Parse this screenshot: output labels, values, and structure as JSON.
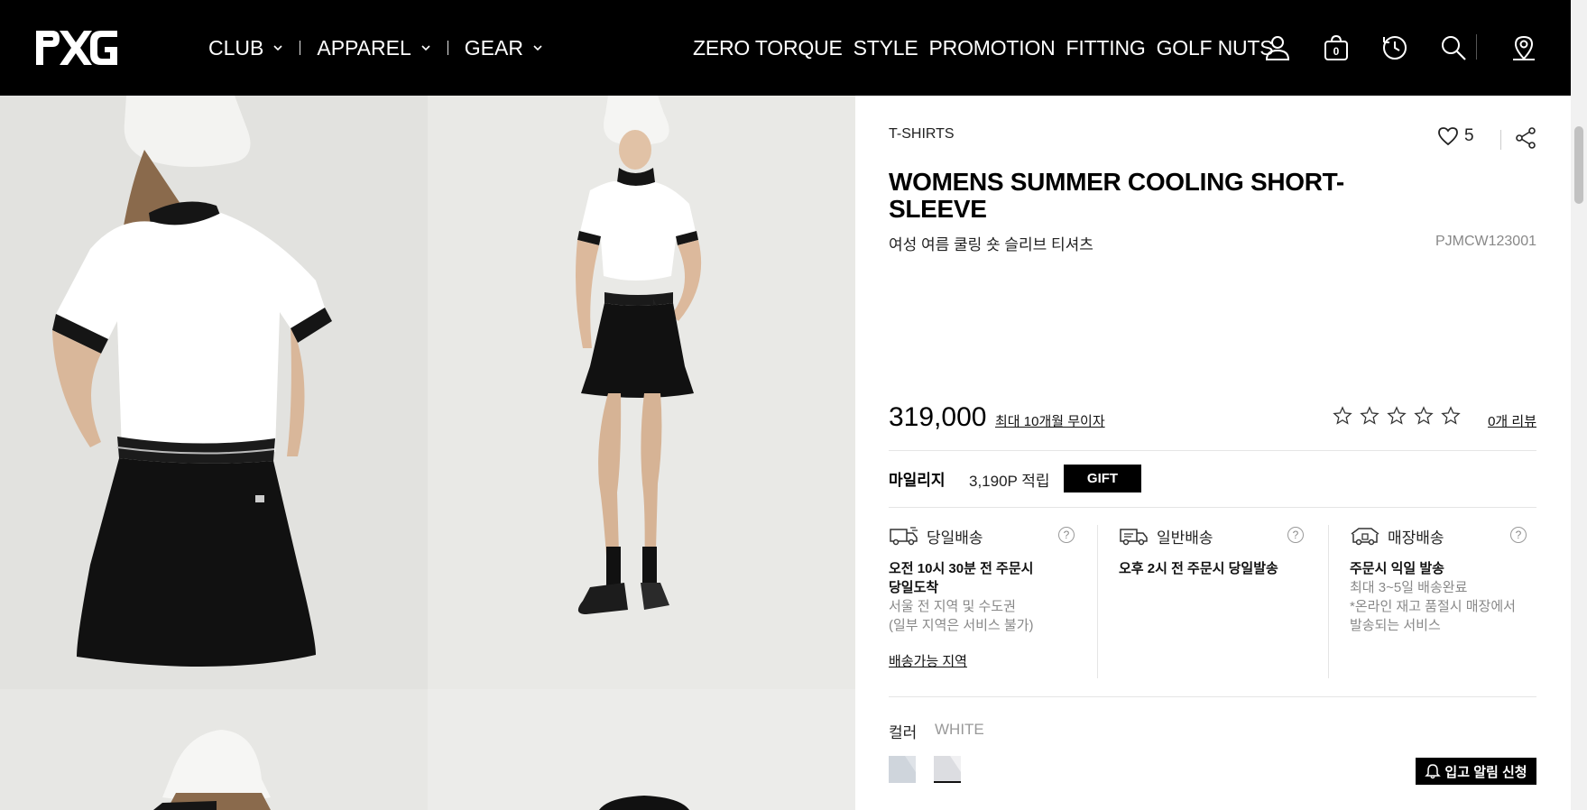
{
  "header": {
    "logo": "PXG",
    "nav_left": [
      {
        "label": "CLUB"
      },
      {
        "label": "APPAREL"
      },
      {
        "label": "GEAR"
      }
    ],
    "nav_right": [
      {
        "label": "ZERO TORQUE"
      },
      {
        "label": "STYLE"
      },
      {
        "label": "PROMOTION"
      },
      {
        "label": "FITTING"
      },
      {
        "label": "GOLF NUTS"
      }
    ],
    "icons": [
      "user-icon",
      "cart-icon",
      "history-icon",
      "search-icon",
      "store-locator-icon"
    ],
    "cart_count": "0"
  },
  "product": {
    "category": "T-SHIRTS",
    "like_count": "5",
    "title": "WOMENS SUMMER COOLING SHORT-SLEEVE",
    "subtitle": "여성 여름 쿨링 숏 슬리브 티셔츠",
    "code": "PJMCW123001",
    "price": "319,000",
    "installment": "최대 10개월 무이자",
    "rating_stars": 0,
    "reviews": "0개 리뷰",
    "mileage_label": "마일리지",
    "mileage_value": "3,190P 적립",
    "gift_label": "GIFT",
    "color_label": "컬러",
    "color_value": "WHITE",
    "notify_label": "입고 알림 신청"
  },
  "shipping": [
    {
      "label": "당일배송",
      "main": "오전 10시 30분 전 주문시\n당일도착",
      "sub": "서울 전 지역 및 수도권\n(일부 지역은 서비스 불가)",
      "link": "배송가능 지역"
    },
    {
      "label": "일반배송",
      "main": "오후 2시 전 주문시 당일발송",
      "sub": "",
      "link": ""
    },
    {
      "label": "매장배송",
      "main": "주문시 익일 발송",
      "sub": "최대 3~5일 배송완료\n*온라인 재고 품절시 매장에서\n발송되는 서비스",
      "link": ""
    }
  ],
  "colors": {
    "header_bg": "#000000",
    "accent": "#000000",
    "muted_text": "#888888"
  }
}
